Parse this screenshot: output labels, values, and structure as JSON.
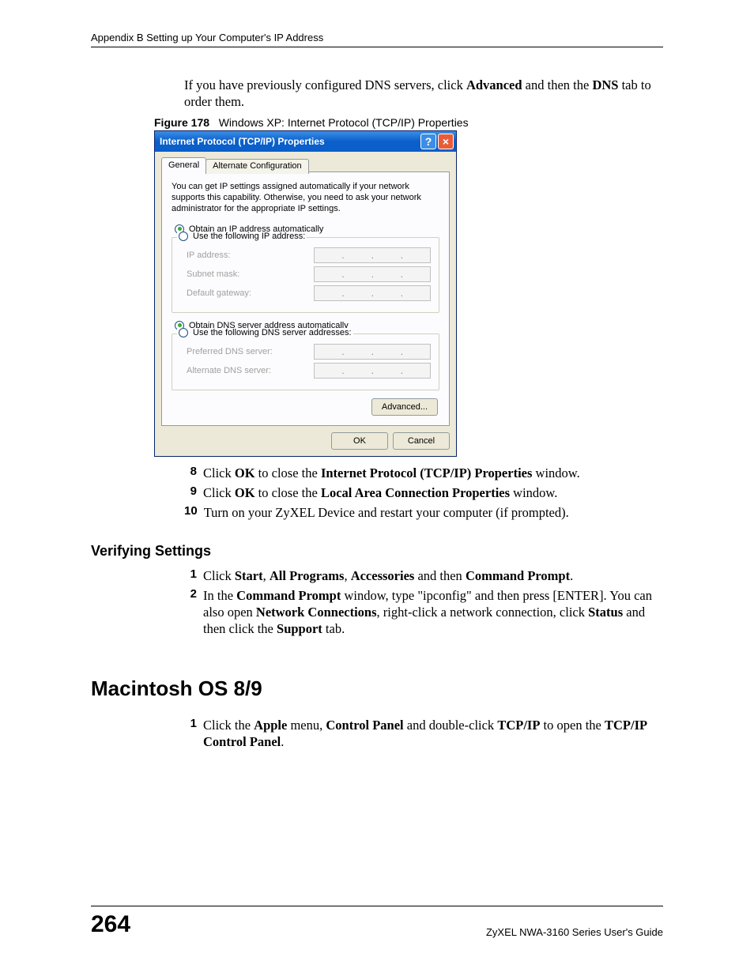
{
  "header": {
    "running_head": "Appendix B Setting up Your Computer's IP Address"
  },
  "intro_text": {
    "prefix": "If you have previously configured DNS servers, click ",
    "bold1": "Advanced",
    "mid": " and then the ",
    "bold2": "DNS",
    "suffix": " tab to order them."
  },
  "figure": {
    "label": "Figure 178",
    "caption": "Windows XP: Internet Protocol (TCP/IP) Properties"
  },
  "dialog": {
    "title": "Internet Protocol (TCP/IP) Properties",
    "tabs": {
      "general": "General",
      "alternate": "Alternate Configuration"
    },
    "description": "You can get IP settings assigned automatically if your network supports this capability. Otherwise, you need to ask your network administrator for the appropriate IP settings.",
    "radio_obtain_ip": "Obtain an IP address automatically",
    "radio_use_ip": "Use the following IP address:",
    "field_ip": "IP address:",
    "field_subnet": "Subnet mask:",
    "field_gateway": "Default gateway:",
    "radio_obtain_dns": "Obtain DNS server address automatically",
    "radio_use_dns": "Use the following DNS server addresses:",
    "field_pref_dns": "Preferred DNS server:",
    "field_alt_dns": "Alternate DNS server:",
    "btn_advanced": "Advanced...",
    "btn_ok": "OK",
    "btn_cancel": "Cancel"
  },
  "steps_a": [
    {
      "n": "8",
      "pre": "Click ",
      "b1": "OK",
      "mid": " to close the ",
      "b2": "Internet Protocol (TCP/IP) Properties",
      "post": " window."
    },
    {
      "n": "9",
      "pre": "Click ",
      "b1": "OK",
      "mid": " to close the ",
      "b2": "Local Area Connection Properties",
      "post": " window."
    }
  ],
  "step_a10": {
    "n": "10",
    "text": "Turn on your ZyXEL Device and restart your computer (if prompted)."
  },
  "verify": {
    "heading": "Verifying Settings",
    "s1": {
      "n": "1",
      "pre": "Click ",
      "b1": "Start",
      "c1": ", ",
      "b2": "All Programs",
      "c2": ", ",
      "b3": "Accessories",
      "c3": " and then ",
      "b4": "Command Prompt",
      "post": "."
    },
    "s2": {
      "n": "2",
      "pre": "In the ",
      "b1": "Command Prompt",
      "mid1": " window, type \"ipconfig\" and then press [ENTER]. You can also open ",
      "b2": "Network Connections",
      "mid2": ", right-click a network connection, click ",
      "b3": "Status",
      "mid3": " and then click the ",
      "b4": "Support",
      "post": " tab."
    }
  },
  "mac": {
    "heading": "Macintosh OS 8/9",
    "s1": {
      "n": "1",
      "pre": "Click the ",
      "b1": "Apple",
      "mid1": " menu, ",
      "b2": "Control Panel",
      "mid2": " and double-click ",
      "b3": "TCP/IP",
      "mid3": " to open the ",
      "b4": "TCP/IP Control Panel",
      "post": "."
    }
  },
  "footer": {
    "page": "264",
    "guide": "ZyXEL NWA-3160 Series User's Guide"
  }
}
